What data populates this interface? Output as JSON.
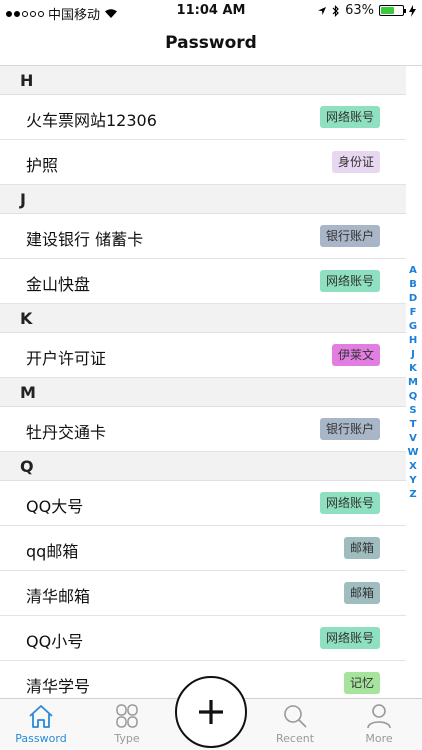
{
  "status_bar": {
    "carrier": "中国移动",
    "time": "11:04 AM",
    "battery": "63%",
    "battery_level": 0.63
  },
  "nav": {
    "title": "Password"
  },
  "sections": [
    {
      "letter": "H",
      "rows": [
        {
          "title": "火车票网站12306",
          "tag": "网络账号",
          "tag_color": "#8ee0c0"
        },
        {
          "title": "护照",
          "tag": "身份证",
          "tag_color": "#e7d7f0"
        }
      ]
    },
    {
      "letter": "J",
      "rows": [
        {
          "title": "建设银行 储蓄卡",
          "tag": "银行账户",
          "tag_color": "#a9b6c7"
        },
        {
          "title": "金山快盘",
          "tag": "网络账号",
          "tag_color": "#8ee0c0"
        }
      ]
    },
    {
      "letter": "K",
      "rows": [
        {
          "title": "开户许可证",
          "tag": "伊莱文",
          "tag_color": "#e27ee2"
        }
      ]
    },
    {
      "letter": "M",
      "rows": [
        {
          "title": "牡丹交通卡",
          "tag": "银行账户",
          "tag_color": "#a9b6c7"
        }
      ]
    },
    {
      "letter": "Q",
      "rows": [
        {
          "title": "QQ大号",
          "tag": "网络账号",
          "tag_color": "#8ee0c0"
        },
        {
          "title": "qq邮箱",
          "tag": "邮箱",
          "tag_color": "#9fbcbf"
        },
        {
          "title": "清华邮箱",
          "tag": "邮箱",
          "tag_color": "#9fbcbf"
        },
        {
          "title": "QQ小号",
          "tag": "网络账号",
          "tag_color": "#8ee0c0"
        },
        {
          "title": "清华学号",
          "tag": "记忆",
          "tag_color": "#a6e39c"
        }
      ]
    }
  ],
  "index_letters": [
    "A",
    "B",
    "D",
    "F",
    "G",
    "H",
    "J",
    "K",
    "M",
    "Q",
    "S",
    "T",
    "V",
    "W",
    "X",
    "Y",
    "Z"
  ],
  "tabs": {
    "password": "Password",
    "type": "Type",
    "recent": "Recent",
    "more": "More"
  },
  "colors": {
    "accent": "#2a8ad6"
  }
}
